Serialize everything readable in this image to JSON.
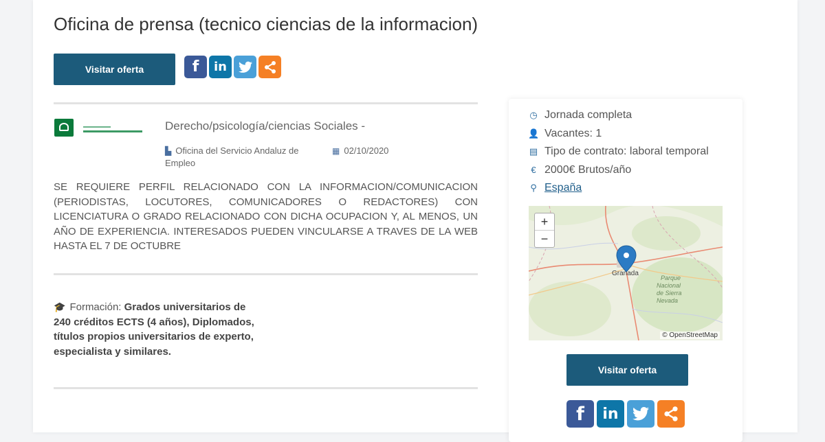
{
  "title": "Oficina de prensa (tecnico ciencias de la informacion)",
  "visit_button": "Visitar oferta",
  "share_icons": [
    "facebook-icon",
    "linkedin-icon",
    "twitter-icon",
    "share-icon"
  ],
  "share_glyphs": {
    "facebook": "f",
    "linkedin": "in",
    "twitter": "🐦",
    "share": "<"
  },
  "offer": {
    "category": "Derecho/psicología/ciencias Sociales -",
    "organization": "Oficina del Servicio Andaluz de Empleo",
    "date": "02/10/2020",
    "description": "SE REQUIERE PERFIL RELACIONADO CON LA INFORMACION/COMUNICACION (PERIODISTAS, LOCUTORES, COMUNICADORES O REDACTORES) CON LICENCIATURA O GRADO RELACIONADO CON DICHA OCUPACION Y, AL MENOS, UN AÑO DE EXPERIENCIA. INTERESADOS PUEDEN VINCULARSE A TRAVES DE LA WEB HASTA EL 7 DE OCTUBRE",
    "formacion_label": "Formación:",
    "formacion_value": "Grados universitarios de 240 créditos ECTS (4 años), Diplomados, títulos propios universitarios de experto, especialista y similares."
  },
  "sidebar": {
    "jornada": "Jornada completa",
    "vacantes": "Vacantes: 1",
    "contrato": "Tipo de contrato: laboral temporal",
    "salario": "2000€ Brutos/año",
    "ubicacion": "España"
  },
  "map": {
    "zoom_in": "+",
    "zoom_out": "−",
    "city": "Granada",
    "park_label": "Parque Nacional de Sierra Nevada",
    "attribution": "© OpenStreetMap"
  },
  "colors": {
    "primary": "#1c5b7b",
    "facebook": "#3b5998",
    "linkedin": "#0e76a8",
    "twitter": "#4aa0d8",
    "share": "#f58025",
    "marker": "#2b7bc4"
  }
}
